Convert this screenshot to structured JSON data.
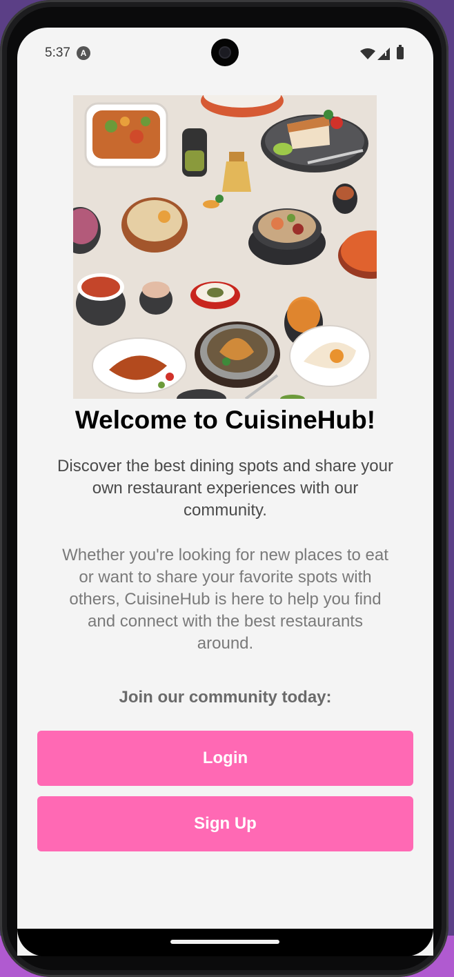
{
  "status_bar": {
    "time": "5:37",
    "notification_icon": "a-letter-icon",
    "icons": [
      "wifi-icon",
      "signal-icon",
      "battery-icon"
    ]
  },
  "hero": {
    "image_icon": "food-spread-illustration"
  },
  "welcome": {
    "title": "Welcome to CuisineHub!",
    "intro": "Discover the best dining spots and share your own restaurant experiences with our community.",
    "detail": "Whether you're looking for new places to eat or want to share your favorite spots with others, CuisineHub is here to help you find and connect with the best restaurants around.",
    "join_prompt": "Join our community today:"
  },
  "actions": {
    "login_label": "Login",
    "signup_label": "Sign Up"
  },
  "colors": {
    "accent": "#ff69b4",
    "screen_bg": "#f4f4f4"
  }
}
